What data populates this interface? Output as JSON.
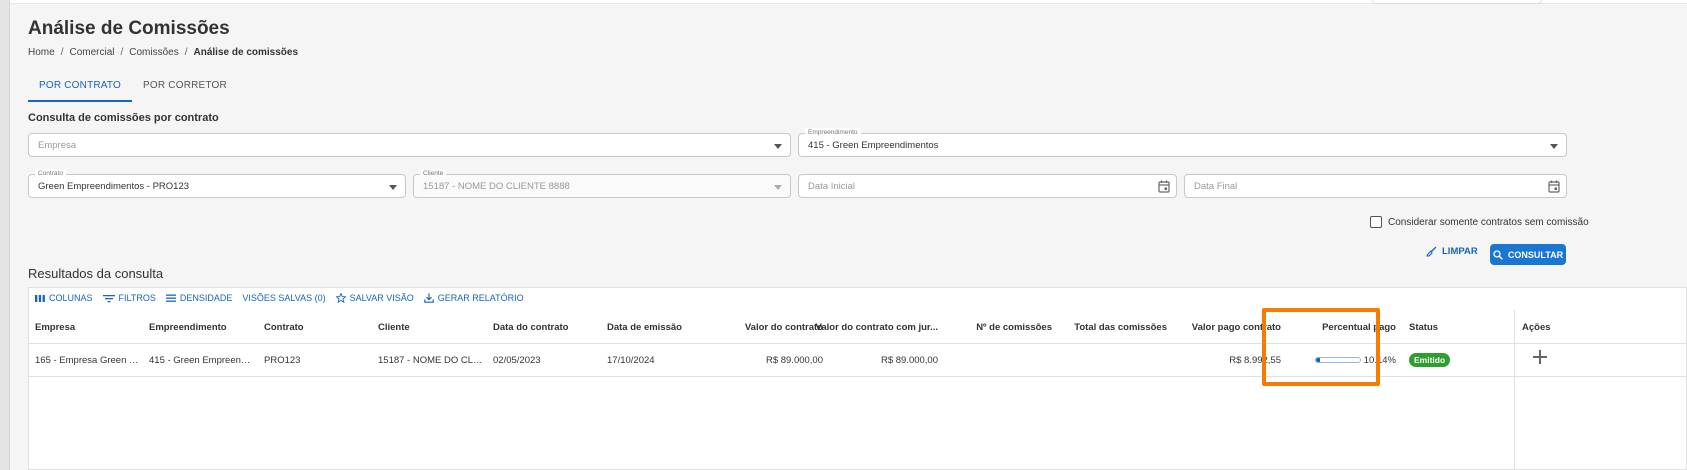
{
  "page": {
    "title": "Análise de Comissões"
  },
  "breadcrumb": [
    "Home",
    "Comercial",
    "Comissões",
    "Análise de comissões"
  ],
  "tabs": [
    {
      "label": "POR CONTRATO",
      "active": true
    },
    {
      "label": "POR CORRETOR",
      "active": false
    }
  ],
  "section_title": "Consulta de comissões por contrato",
  "filters": {
    "empresa": {
      "placeholder": "Empresa",
      "value": ""
    },
    "empreendimento": {
      "label": "Empreendimento",
      "value": "415 - Green Empreendimentos"
    },
    "contrato": {
      "label": "Contrato",
      "value": "Green Empreendimentos - PRO123"
    },
    "cliente": {
      "label": "Cliente",
      "value": "15187 - NOME DO CLIENTE 8888"
    },
    "data_inicial": {
      "placeholder": "Data Inicial"
    },
    "data_final": {
      "placeholder": "Data Final"
    },
    "checkbox_label": "Considerar somente contratos sem comissão",
    "checkbox_checked": false
  },
  "buttons": {
    "limpar": "LIMPAR",
    "consultar": "CONSULTAR"
  },
  "results": {
    "title": "Resultados da consulta",
    "toolbar": {
      "colunas": "COLUNAS",
      "filtros": "FILTROS",
      "densidade": "DENSIDADE",
      "visoes_salvas": "VISÕES SALVAS (0)",
      "salvar_visao": "SALVAR VISÃO",
      "gerar_relatorio": "GERAR RELATÓRIO"
    },
    "columns": {
      "empresa": "Empresa",
      "empreendimento": "Empreendimento",
      "contrato": "Contrato",
      "cliente": "Cliente",
      "data_contrato": "Data do contrato",
      "data_emissao": "Data de emissão",
      "valor_contrato": "Valor do contrato",
      "valor_contrato_juros": "Valor do contrato com jur...",
      "num_comissoes": "Nº de comissões",
      "total_comissoes": "Total das comissões",
      "valor_pago": "Valor pago contrato",
      "percentual_pago": "Percentual pago",
      "status": "Status",
      "acoes": "Ações"
    },
    "rows": [
      {
        "empresa": "165 - Empresa Green & ...",
        "empreendimento": "415 - Green Empreendi...",
        "contrato": "PRO123",
        "cliente": "15187 - NOME DO CLIE...",
        "data_contrato": "02/05/2023",
        "data_emissao": "17/10/2024",
        "valor_contrato": "R$ 89.000,00",
        "valor_contrato_juros": "R$ 89.000,00",
        "num_comissoes": "",
        "total_comissoes": "",
        "valor_pago": "R$ 8.992,55",
        "percentual_pago": "10.14%",
        "percentual_fraction": 0.1014,
        "status": "Emitido"
      }
    ]
  },
  "colors": {
    "accent": "#1565c0",
    "status_emitido": "#2e9e2e",
    "highlight": "#f57c00"
  }
}
